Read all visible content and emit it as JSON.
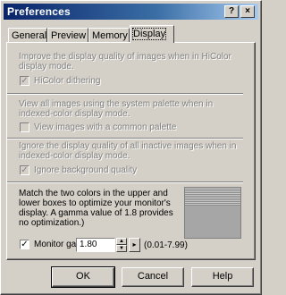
{
  "window": {
    "title": "Preferences",
    "help_glyph": "?",
    "close_glyph": "×"
  },
  "tabs": [
    {
      "label": "General",
      "active": false
    },
    {
      "label": "Preview",
      "active": false
    },
    {
      "label": "Memory",
      "active": false
    },
    {
      "label": "Display",
      "active": true
    }
  ],
  "sections": {
    "hicolor": {
      "description": "Improve the display quality of images when in HiColor display mode.",
      "checkbox_label": "HiColor dithering",
      "checked": true,
      "enabled": false
    },
    "palette": {
      "description": "View all images using the system palette when in indexed-color display mode.",
      "checkbox_label": "View images with a common palette",
      "checked": false,
      "enabled": false
    },
    "background": {
      "description": "Ignore the display quality of all inactive images when in indexed-color display mode.",
      "checkbox_label": "Ignore background quality",
      "checked": true,
      "enabled": false
    },
    "gamma": {
      "description": "Match the two colors in the upper and lower boxes to optimize your monitor's display. A gamma value of 1.8 provides no optimization.)",
      "checkbox_label": "Monitor gamma:",
      "checked": true,
      "value": "1.80",
      "range": "(0.01-7.99)",
      "spin_up_glyph": "▲",
      "spin_down_glyph": "▼",
      "drop_glyph": "▸"
    }
  },
  "buttons": {
    "ok": "OK",
    "cancel": "Cancel",
    "help": "Help"
  },
  "check_glyph": "✓"
}
